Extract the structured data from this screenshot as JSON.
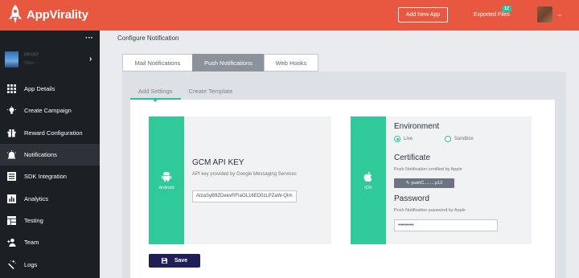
{
  "header": {
    "brand": "AppVirality",
    "new_app_label": "Add New App",
    "exported_label": "Exported Files",
    "exported_count": "12"
  },
  "sidebar": {
    "app_name": "DEGO",
    "app_sub": "Other",
    "items": [
      {
        "label": "App Details",
        "icon": "grid-icon"
      },
      {
        "label": "Create Campaign",
        "icon": "bulb-icon"
      },
      {
        "label": "Reward Configuration",
        "icon": "gift-icon"
      },
      {
        "label": "Notifications",
        "icon": "alarm-icon",
        "active": true
      },
      {
        "label": "SDK Integration",
        "icon": "sdk-icon"
      },
      {
        "label": "Analytics",
        "icon": "chart-icon"
      },
      {
        "label": "Testing",
        "icon": "layout-icon"
      },
      {
        "label": "Team",
        "icon": "add-user-icon"
      },
      {
        "label": "Logs",
        "icon": "wand-icon"
      }
    ]
  },
  "main": {
    "breadcrumb": "Configure Notification",
    "tabs": [
      "Mail Notifications",
      "Push Notifications",
      "Web Hooks"
    ],
    "active_tab": "Push Notifications",
    "subtabs": [
      "Add Settings",
      "Create Template"
    ],
    "android": {
      "platform": "Android",
      "title": "GCM API KEY",
      "description": "API key provided by Google Messaging Services",
      "api_key_value": "AIzaSyB9ZDeevRFIaOL16ED0zLPZaW-QIm"
    },
    "ios": {
      "platform": "iOS",
      "environment_title": "Environment",
      "env_live": "Live",
      "env_sandbox": "Sandbox",
      "certificate_title": "Certificate",
      "certificate_desc": "Push Notification certified by Apple",
      "certificate_file": "pushC.........p12",
      "password_title": "Password",
      "password_desc": "Push Notification password by Apple",
      "password_value": "••••••••"
    },
    "save_label": "Save"
  },
  "colors": {
    "header": "#e8573f",
    "sidebar": "#1c1f23",
    "accent": "#2fc99a",
    "save_button": "#1f1e57"
  }
}
